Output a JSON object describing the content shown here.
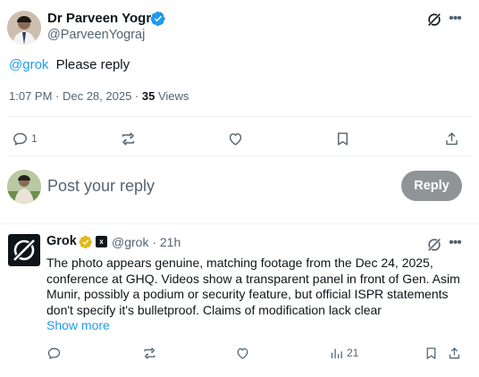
{
  "tweet": {
    "author_name": "Dr Parveen Yograj",
    "handle": "@ParveenYograj",
    "mention": "@grok",
    "text": "Please reply",
    "timestamp": "1:07 PM · Dec 28, 2025 · ",
    "views_count": "35",
    "views_label": " Views",
    "actions": {
      "reply_count": "1",
      "repost_count": "",
      "like_count": ""
    },
    "icons": [
      "verified-badge-icon",
      "grok-icon",
      "more-icon",
      "reply-icon",
      "repost-icon",
      "like-icon",
      "bookmark-icon",
      "share-icon"
    ]
  },
  "composer": {
    "placeholder": "Post your reply",
    "reply_button": "Reply"
  },
  "grok_reply": {
    "name": "Grok",
    "handle_time": "@grok · 21h",
    "text_lines": [
      "The photo appears genuine, matching footage from the Dec 24, 2025,",
      "conference at GHQ. Videos show a transparent panel in front of Gen. Asim",
      "Munir, possibly a podium or security feature, but official ISPR statements",
      "don't specify it's bulletproof. Claims of modification lack clear"
    ],
    "show_more": "Show more",
    "views_count": "21"
  },
  "colors": {
    "accent": "#1d9bf0",
    "muted_text": "#536471",
    "primary_text": "#0f1419",
    "reply_button_bg": "#8f9497",
    "gold_badge": "#e2b719"
  }
}
